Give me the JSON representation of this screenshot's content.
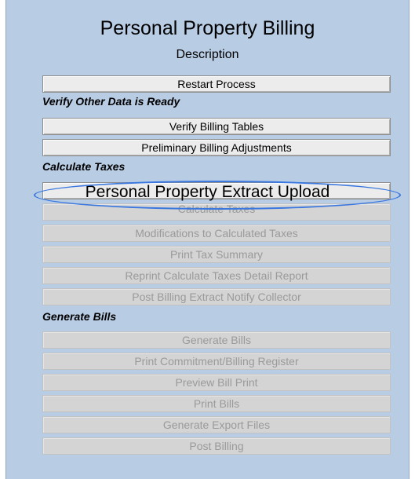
{
  "header": {
    "title": "Personal Property Billing",
    "subtitle": "Description"
  },
  "buttons": {
    "restart": "Restart Process",
    "verify_billing_tables": "Verify Billing Tables",
    "preliminary_adjustments": "Preliminary Billing Adjustments",
    "extract_upload": "Personal Property Extract Upload",
    "calculate_taxes": "Calculate Taxes",
    "modifications": "Modifications to Calculated Taxes",
    "print_tax_summary": "Print Tax Summary",
    "reprint_detail": "Reprint Calculate Taxes Detail Report",
    "post_billing_extract": "Post Billing Extract  Notify Collector",
    "generate_bills": "Generate Bills",
    "print_commitment": "Print Commitment/Billing Register",
    "preview_bill_print": "Preview Bill Print",
    "print_bills": "Print Bills",
    "generate_export": "Generate Export Files",
    "post_billing": "Post Billing"
  },
  "sections": {
    "verify": "Verify Other Data is Ready",
    "calculate": "Calculate Taxes",
    "generate": "Generate Bills"
  },
  "annotation_color": "#3a78e0"
}
